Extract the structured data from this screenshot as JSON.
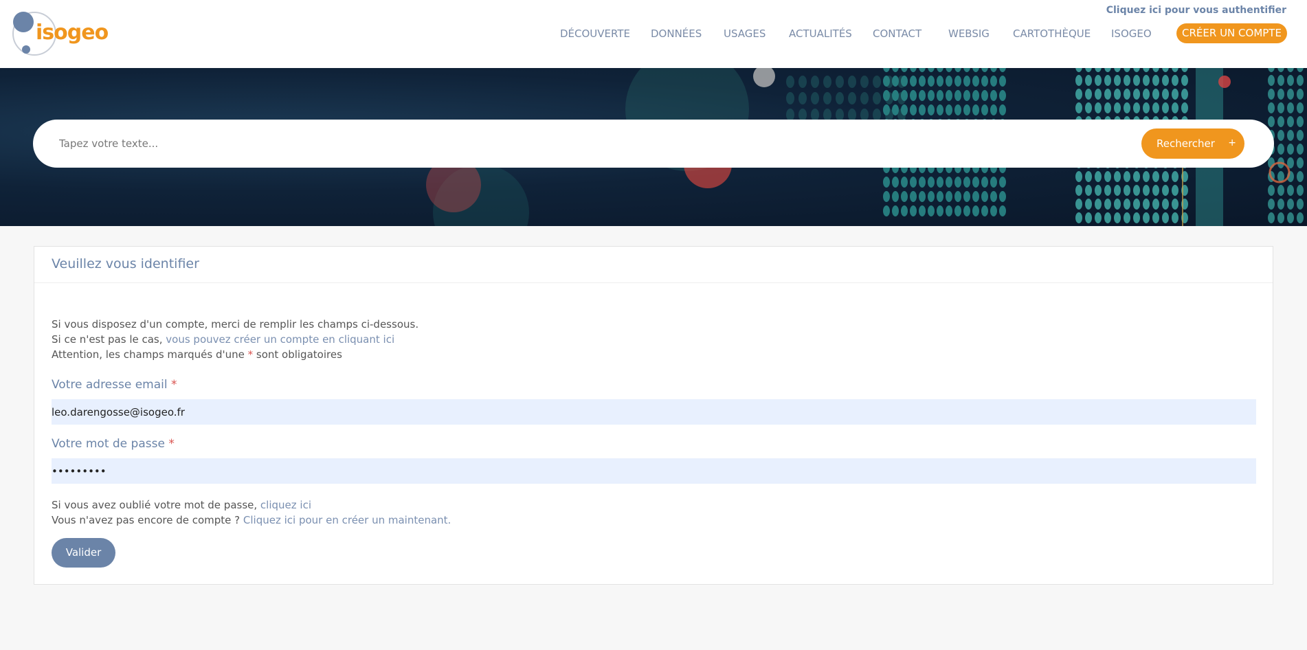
{
  "header": {
    "logo_text": "isogeo",
    "auth_link": "Cliquez ici pour vous authentifier",
    "nav": [
      "DÉCOUVERTE",
      "DONNÉES",
      "USAGES",
      "ACTUALITÉS",
      "CONTACT",
      "WEBSIG",
      "CARTOTHÈQUE",
      "ISOGEO"
    ],
    "cta": "CRÉER UN COMPTE"
  },
  "search": {
    "placeholder": "Tapez votre texte...",
    "button": "Rechercher",
    "plus": "+"
  },
  "form": {
    "title": "Veuillez vous identifier",
    "intro_line1": "Si vous disposez d'un compte, merci de remplir les champs ci-dessous.",
    "intro_line2_prefix": "Si ce n'est pas le cas, ",
    "intro_line2_link": "vous pouvez créer un compte en cliquant ici",
    "intro_line3_prefix": "Attention, les champs marqués d'une ",
    "intro_line3_star": "*",
    "intro_line3_suffix": " sont obligatoires",
    "email_label": "Votre adresse email ",
    "email_star": "*",
    "email_value": "leo.darengosse@isogeo.fr",
    "password_label": "Votre mot de passe ",
    "password_star": "*",
    "password_value": "•••••••••",
    "forgot_prefix": "Si vous avez oublié votre mot de passe, ",
    "forgot_link": "cliquez ici",
    "noaccount_prefix": "Vous n'avez pas encore de compte ? ",
    "noaccount_link": "Cliquez ici pour en créer un maintenant.",
    "submit": "Valider"
  },
  "colors": {
    "accent": "#f0961e",
    "primary": "#6b84a8",
    "input_bg": "#e8f0fe",
    "required": "#d9534f"
  }
}
